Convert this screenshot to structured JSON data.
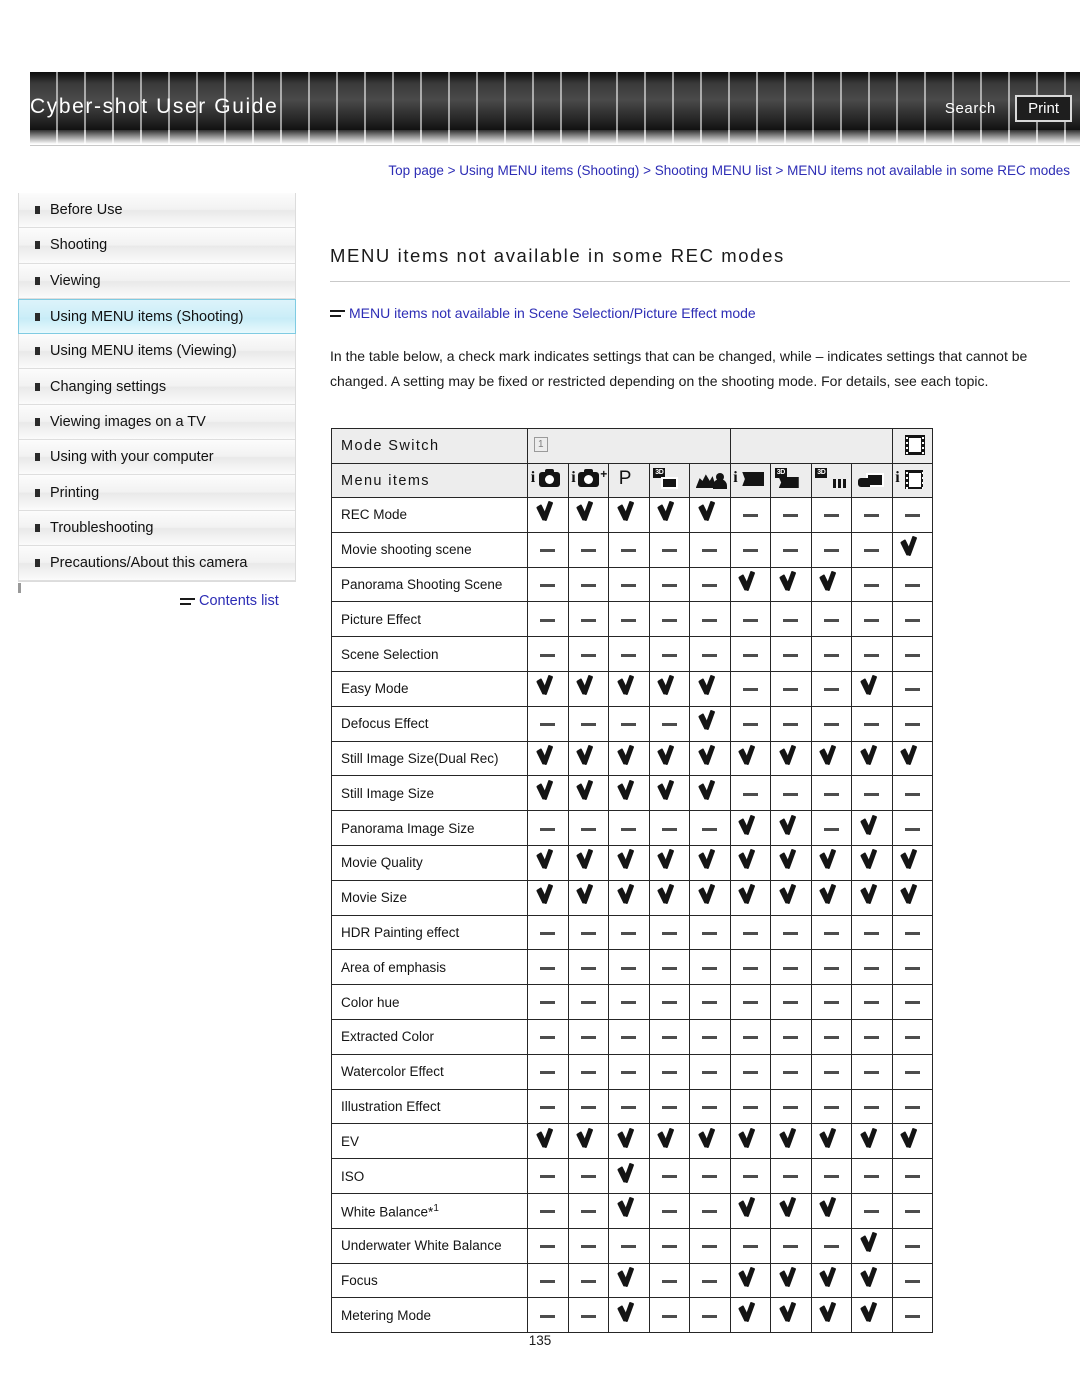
{
  "header": {
    "title": "Cyber-shot User Guide",
    "search_label": "Search",
    "print_label": "Print"
  },
  "breadcrumb": {
    "text": "Top page > Using MENU items (Shooting) > Shooting MENU list > MENU items not available in some REC modes"
  },
  "sidebar": {
    "items": [
      {
        "label": "Before Use",
        "selected": false
      },
      {
        "label": "Shooting",
        "selected": false
      },
      {
        "label": "Viewing",
        "selected": false
      },
      {
        "label": "Using MENU items (Shooting)",
        "selected": true
      },
      {
        "label": "Using MENU items (Viewing)",
        "selected": false
      },
      {
        "label": "Changing settings",
        "selected": false
      },
      {
        "label": "Viewing images on a TV",
        "selected": false
      },
      {
        "label": "Using with your computer",
        "selected": false
      },
      {
        "label": "Printing",
        "selected": false
      },
      {
        "label": "Troubleshooting",
        "selected": false
      },
      {
        "label": "Precautions/About this camera",
        "selected": false
      }
    ],
    "contents_list_label": "Contents list"
  },
  "main": {
    "page_title": "MENU items not available in some REC modes",
    "related_link": "MENU items not available in Scene Selection/Picture Effect mode",
    "intro": "In the table below, a check mark indicates settings that can be changed, while – indicates settings that cannot be changed. A setting may be fixed or restricted depending on the shooting mode. For details, see each topic.",
    "page_number": "135"
  },
  "table": {
    "mode_switch_label": "Mode Switch",
    "menu_items_label": "Menu items",
    "group_badge": "1",
    "columns": [
      {
        "icon": "intelligent-auto-icon",
        "name": "i-camera"
      },
      {
        "icon": "superior-auto-icon",
        "name": "i-camera-plus"
      },
      {
        "icon": "program-auto-icon",
        "name": "P"
      },
      {
        "icon": "3d-still-image-icon",
        "name": "3D still"
      },
      {
        "icon": "scene-selection-icon",
        "name": "scene"
      },
      {
        "icon": "i-sweep-panorama-icon",
        "name": "i-panorama"
      },
      {
        "icon": "3d-sweep-panorama-icon",
        "name": "3D panorama"
      },
      {
        "icon": "sweep-multi-angle-icon",
        "name": "3D multi angle"
      },
      {
        "icon": "background-defocus-icon",
        "name": "defocus"
      },
      {
        "icon": "movie-mode-icon",
        "name": "i-movie"
      }
    ],
    "rows": [
      {
        "label": "REC Mode",
        "marks": [
          "y",
          "y",
          "y",
          "y",
          "y",
          "n",
          "n",
          "n",
          "n",
          "n"
        ]
      },
      {
        "label": "Movie shooting scene",
        "marks": [
          "n",
          "n",
          "n",
          "n",
          "n",
          "n",
          "n",
          "n",
          "n",
          "y"
        ]
      },
      {
        "label": "Panorama Shooting Scene",
        "marks": [
          "n",
          "n",
          "n",
          "n",
          "n",
          "y",
          "y",
          "y",
          "n",
          "n"
        ]
      },
      {
        "label": "Picture Effect",
        "marks": [
          "n",
          "n",
          "n",
          "n",
          "n",
          "n",
          "n",
          "n",
          "n",
          "n"
        ]
      },
      {
        "label": "Scene Selection",
        "marks": [
          "n",
          "n",
          "n",
          "n",
          "n",
          "n",
          "n",
          "n",
          "n",
          "n"
        ]
      },
      {
        "label": "Easy Mode",
        "marks": [
          "y",
          "y",
          "y",
          "y",
          "y",
          "n",
          "n",
          "n",
          "y",
          "n"
        ]
      },
      {
        "label": "Defocus Effect",
        "marks": [
          "n",
          "n",
          "n",
          "n",
          "y",
          "n",
          "n",
          "n",
          "n",
          "n"
        ]
      },
      {
        "label": "Still Image Size(Dual Rec)",
        "marks": [
          "y",
          "y",
          "y",
          "y",
          "y",
          "y",
          "y",
          "y",
          "y",
          "y"
        ]
      },
      {
        "label": "Still Image Size",
        "marks": [
          "y",
          "y",
          "y",
          "y",
          "y",
          "n",
          "n",
          "n",
          "n",
          "n"
        ]
      },
      {
        "label": "Panorama Image Size",
        "marks": [
          "n",
          "n",
          "n",
          "n",
          "n",
          "y",
          "y",
          "n",
          "y",
          "n"
        ]
      },
      {
        "label": "Movie Quality",
        "marks": [
          "y",
          "y",
          "y",
          "y",
          "y",
          "y",
          "y",
          "y",
          "y",
          "y"
        ]
      },
      {
        "label": "Movie Size",
        "marks": [
          "y",
          "y",
          "y",
          "y",
          "y",
          "y",
          "y",
          "y",
          "y",
          "y"
        ]
      },
      {
        "label": "HDR Painting effect",
        "marks": [
          "n",
          "n",
          "n",
          "n",
          "n",
          "n",
          "n",
          "n",
          "n",
          "n"
        ]
      },
      {
        "label": "Area of emphasis",
        "marks": [
          "n",
          "n",
          "n",
          "n",
          "n",
          "n",
          "n",
          "n",
          "n",
          "n"
        ]
      },
      {
        "label": "Color hue",
        "marks": [
          "n",
          "n",
          "n",
          "n",
          "n",
          "n",
          "n",
          "n",
          "n",
          "n"
        ]
      },
      {
        "label": "Extracted Color",
        "marks": [
          "n",
          "n",
          "n",
          "n",
          "n",
          "n",
          "n",
          "n",
          "n",
          "n"
        ]
      },
      {
        "label": "Watercolor Effect",
        "marks": [
          "n",
          "n",
          "n",
          "n",
          "n",
          "n",
          "n",
          "n",
          "n",
          "n"
        ]
      },
      {
        "label": "Illustration Effect",
        "marks": [
          "n",
          "n",
          "n",
          "n",
          "n",
          "n",
          "n",
          "n",
          "n",
          "n"
        ]
      },
      {
        "label": "EV",
        "marks": [
          "y",
          "y",
          "y",
          "y",
          "y",
          "y",
          "y",
          "y",
          "y",
          "y"
        ]
      },
      {
        "label": "ISO",
        "marks": [
          "n",
          "n",
          "y",
          "n",
          "n",
          "n",
          "n",
          "n",
          "n",
          "n"
        ]
      },
      {
        "label": "White Balance*1",
        "marks": [
          "n",
          "n",
          "y",
          "n",
          "n",
          "y",
          "y",
          "y",
          "n",
          "n"
        ]
      },
      {
        "label": "Underwater White Balance",
        "marks": [
          "n",
          "n",
          "n",
          "n",
          "n",
          "n",
          "n",
          "n",
          "y",
          "n"
        ]
      },
      {
        "label": "Focus",
        "marks": [
          "n",
          "n",
          "y",
          "n",
          "n",
          "y",
          "y",
          "y",
          "y",
          "n"
        ]
      },
      {
        "label": "Metering Mode",
        "marks": [
          "n",
          "n",
          "y",
          "n",
          "n",
          "y",
          "y",
          "y",
          "y",
          "n"
        ]
      }
    ]
  },
  "colors": {
    "link": "#2d2db5",
    "selected_nav": "#cceef8",
    "banner_dark": "#1a1a1a"
  }
}
